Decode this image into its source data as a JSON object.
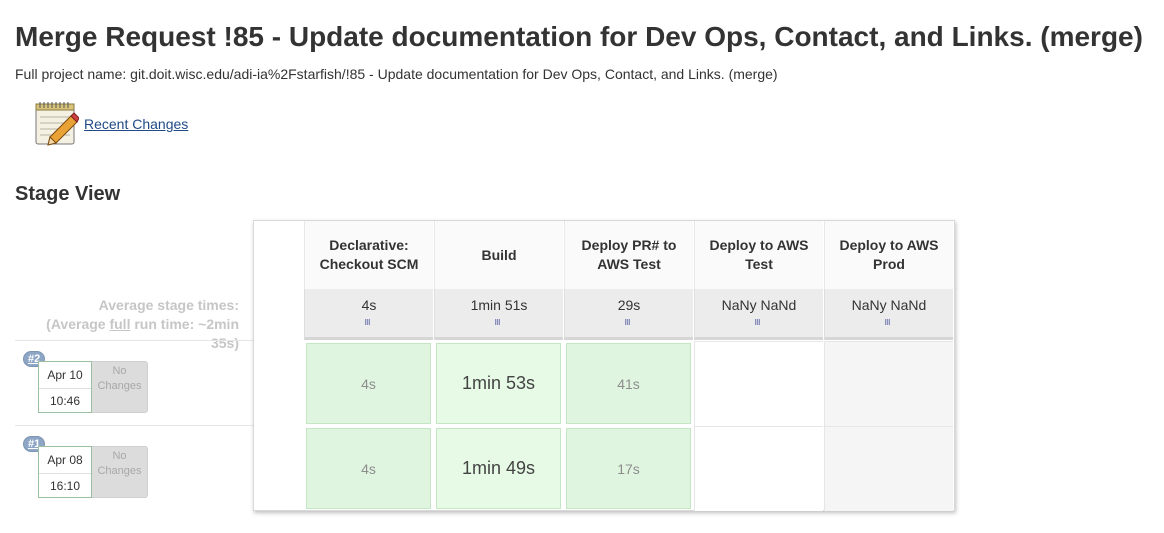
{
  "page": {
    "title": "Merge Request !85 - Update documentation for Dev Ops, Contact, and Links. (merge)",
    "full_name": "Full project name: git.doit.wisc.edu/adi-ia%2Fstarfish/!85 - Update documentation for Dev Ops, Contact, and Links. (merge)",
    "recent_changes": "Recent Changes",
    "recent_changes_icon": "notepad-icon",
    "stage_view": "Stage View"
  },
  "stage_view": {
    "avg_label_prefix": "Average stage times:",
    "avg_label_open": "(Average ",
    "avg_label_full": "full",
    "avg_label_rest": " run time: ~2min",
    "avg_label_end": "35s)",
    "stages": [
      {
        "name": "Declarative: Checkout SCM",
        "avg": "4s"
      },
      {
        "name": "Build",
        "avg": "1min 51s"
      },
      {
        "name": "Deploy PR# to AWS Test",
        "avg": "29s"
      },
      {
        "name": "Deploy to AWS Test",
        "avg": "NaNy NaNd"
      },
      {
        "name": "Deploy to AWS Prod",
        "avg": "NaNy NaNd"
      }
    ],
    "builds": [
      {
        "number": "#2",
        "date": "Apr 10",
        "time": "10:46",
        "changes": "No Changes",
        "durations": [
          "4s",
          "1min 53s",
          "41s",
          "",
          ""
        ]
      },
      {
        "number": "#1",
        "date": "Apr 08",
        "time": "16:10",
        "changes": "No Changes",
        "durations": [
          "4s",
          "1min 49s",
          "17s",
          "",
          ""
        ]
      }
    ],
    "colors": {
      "success_bg": "#e0f5e0",
      "success_border": "#c4e6c4",
      "badge": "#8ea6c6"
    }
  }
}
